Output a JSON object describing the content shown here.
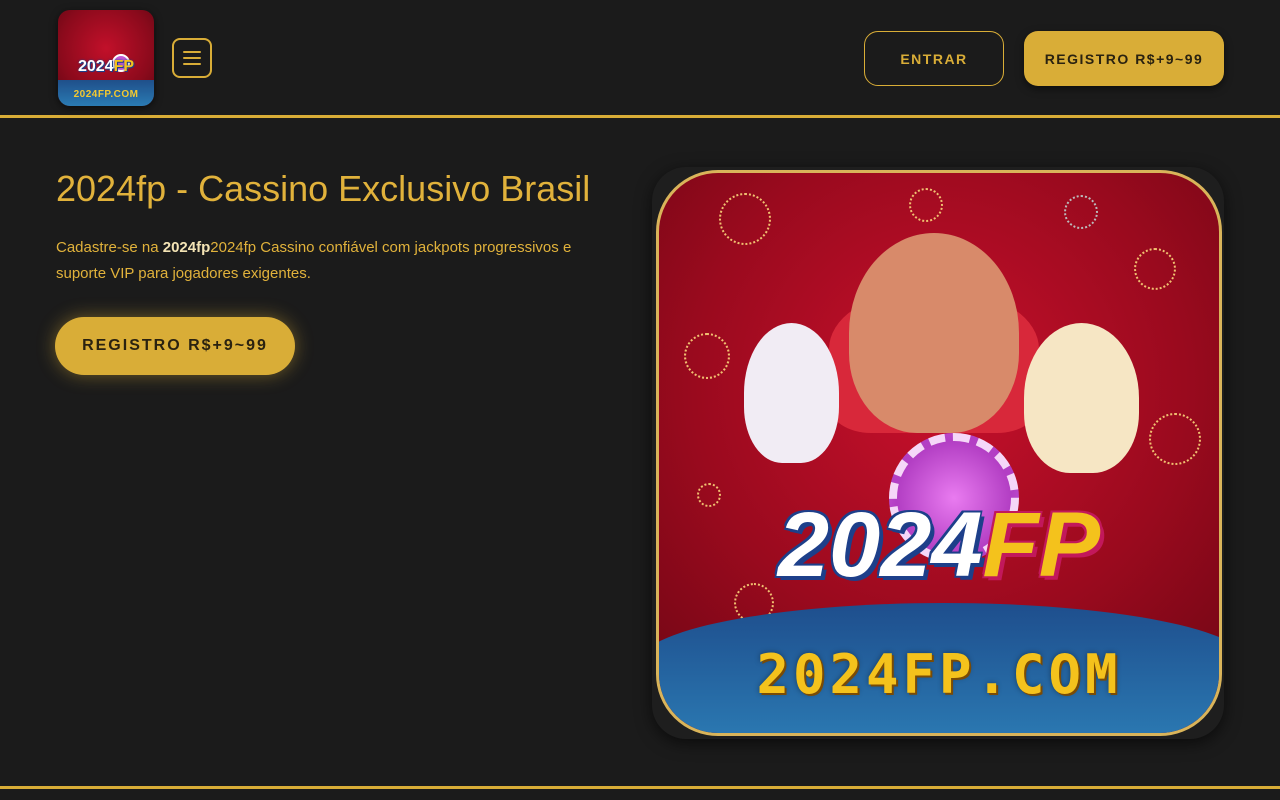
{
  "header": {
    "logo_alt": "2024FP.COM",
    "logo_text_main": "2024",
    "logo_text_fp": "FP",
    "logo_text_domain": "2024FP.COM",
    "menu_icon": "hamburger-menu-icon",
    "login_label": "ENTRAR",
    "register_label": "REGISTRO R$+9~99"
  },
  "hero": {
    "title": "2024fp - Cassino Exclusivo Brasil",
    "desc_prefix": "Cadastre-se na ",
    "desc_bold": "2024fp",
    "desc_suffix": "2024fp Cassino confiável com jackpots progressivos e suporte VIP para jogadores exigentes.",
    "cta_label": "REGISTRO R$+9~99",
    "art_brand_main": "2024",
    "art_brand_fp": "FP",
    "art_domain": "2024FP.COM"
  },
  "colors": {
    "background": "#1b1b1b",
    "accent_gold": "#d9ad37",
    "title_gold": "#e1b23b"
  }
}
